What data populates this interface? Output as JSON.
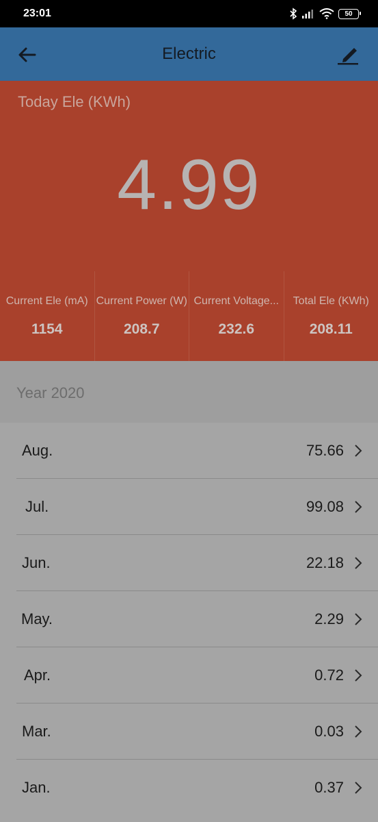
{
  "status_bar": {
    "time": "23:01",
    "battery": "50",
    "icons": [
      "bluetooth-icon",
      "signal-icon",
      "wifi-icon",
      "battery-icon"
    ]
  },
  "toolbar": {
    "title": "Electric",
    "back_icon": "arrow-left-icon",
    "edit_icon": "edit-pen-icon"
  },
  "today": {
    "label": "Today Ele (KWh)",
    "value": "4.99"
  },
  "stats": [
    {
      "label": "Current Ele (mA)",
      "value": "1154"
    },
    {
      "label": "Current Power (W)",
      "value": "208.7"
    },
    {
      "label": "Current Voltage...",
      "value": "232.6"
    },
    {
      "label": "Total Ele (KWh)",
      "value": "208.11"
    }
  ],
  "year": {
    "label": "Year 2020"
  },
  "months": [
    {
      "name": "Aug.",
      "value": "75.66"
    },
    {
      "name": "Jul.",
      "value": "99.08"
    },
    {
      "name": "Jun.",
      "value": "22.18"
    },
    {
      "name": "May.",
      "value": "2.29"
    },
    {
      "name": "Apr.",
      "value": "0.72"
    },
    {
      "name": "Mar.",
      "value": "0.03"
    },
    {
      "name": "Jan.",
      "value": "0.37"
    }
  ],
  "colors": {
    "toolbar": "#33699a",
    "panel": "#a9412c",
    "overlay_gray": "#a5a5a5"
  }
}
